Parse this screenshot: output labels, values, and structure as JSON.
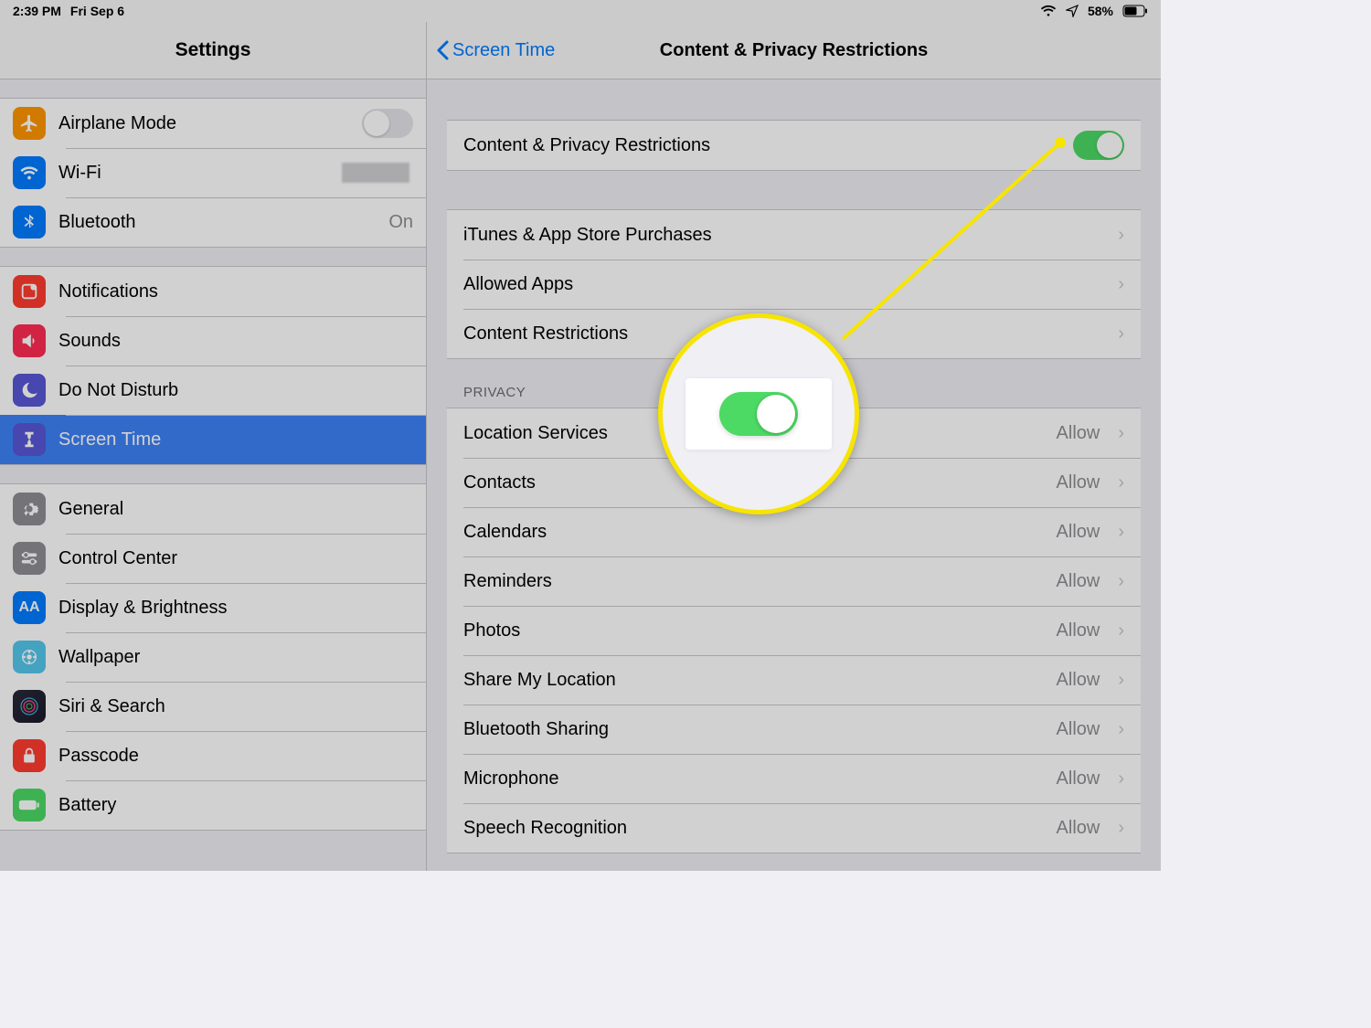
{
  "status": {
    "time": "2:39 PM",
    "date": "Fri Sep 6",
    "battery_pct": "58%"
  },
  "sidebar": {
    "title": "Settings",
    "g1": {
      "airplane": "Airplane Mode",
      "wifi": "Wi-Fi",
      "bt": "Bluetooth",
      "bt_val": "On"
    },
    "g2": {
      "notifications": "Notifications",
      "sounds": "Sounds",
      "dnd": "Do Not Disturb",
      "screen_time": "Screen Time"
    },
    "g3": {
      "general": "General",
      "control_center": "Control Center",
      "display": "Display & Brightness",
      "wallpaper": "Wallpaper",
      "siri": "Siri & Search",
      "passcode": "Passcode",
      "battery": "Battery"
    }
  },
  "detail": {
    "back": "Screen Time",
    "title": "Content & Privacy Restrictions",
    "toggle_row": "Content & Privacy Restrictions",
    "sec1": {
      "itunes": "iTunes & App Store Purchases",
      "allowed": "Allowed Apps",
      "content": "Content Restrictions"
    },
    "privacy_hdr": "PRIVACY",
    "privacy": [
      {
        "label": "Location Services",
        "value": "Allow"
      },
      {
        "label": "Contacts",
        "value": "Allow"
      },
      {
        "label": "Calendars",
        "value": "Allow"
      },
      {
        "label": "Reminders",
        "value": "Allow"
      },
      {
        "label": "Photos",
        "value": "Allow"
      },
      {
        "label": "Share My Location",
        "value": "Allow"
      },
      {
        "label": "Bluetooth Sharing",
        "value": "Allow"
      },
      {
        "label": "Microphone",
        "value": "Allow"
      },
      {
        "label": "Speech Recognition",
        "value": "Allow"
      }
    ]
  }
}
